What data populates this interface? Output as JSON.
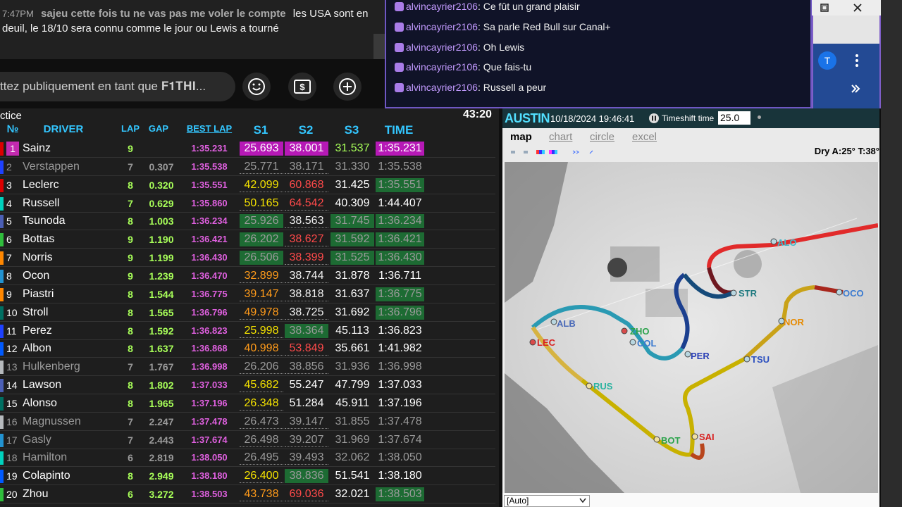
{
  "yt_chat": {
    "time": "7:47PM",
    "author": "sajeu cette fois tu ne vas pas me voler le compte",
    "message": "les USA sont en deuil, le 18/10 sera connu comme le jour ou Lewis a tourné",
    "input_placeholder": "ttez publiquement en tant que 𝐅𝟏𝐓𝐇𝐈...",
    "emoji_icon": "emoji-icon",
    "dollar_icon": "super-chat-icon",
    "add_icon": "add-icon"
  },
  "twitch_chat": {
    "messages": [
      {
        "user": "alvincayrier2106",
        "text": "Ce fût un grand plaisir"
      },
      {
        "user": "alvincayrier2106",
        "text": "Sa parle Red Bull sur Canal+"
      },
      {
        "user": "alvincayrier2106",
        "text": "Oh Lewis"
      },
      {
        "user": "alvincayrier2106",
        "text": "Que fais-tu"
      },
      {
        "user": "alvincayrier2106",
        "text": "Russell a peur"
      }
    ]
  },
  "browser": {
    "avatar_letter": "T"
  },
  "timing": {
    "session": "ctice",
    "clock": "43:20",
    "headers": {
      "no": "№",
      "driver": "DRIVER",
      "lap": "LAP",
      "gap": "GAP",
      "best": "BEST LAP",
      "s1": "S1",
      "s2": "S2",
      "s3": "S3",
      "time": "TIME"
    },
    "rows": [
      {
        "pos": "1",
        "team": "#dc0000",
        "driver": "Sainz",
        "lap": "9",
        "gap": "",
        "best": "1:35.231",
        "s1": "25.693",
        "s2": "38.001",
        "s3": "31.537",
        "time": "1:35.231"
      },
      {
        "pos": "2",
        "team": "#1e41ff",
        "driver": "Verstappen",
        "lap": "7",
        "gap": "0.307",
        "best": "1:35.538",
        "s1": "25.771",
        "s2": "38.171",
        "s3": "31.330",
        "time": "1:35.538"
      },
      {
        "pos": "3",
        "team": "#dc0000",
        "driver": "Leclerc",
        "lap": "8",
        "gap": "0.320",
        "best": "1:35.551",
        "s1": "42.099",
        "s2": "60.868",
        "s3": "31.425",
        "time": "1:35.551"
      },
      {
        "pos": "4",
        "team": "#00d2be",
        "driver": "Russell",
        "lap": "7",
        "gap": "0.629",
        "best": "1:35.860",
        "s1": "50.165",
        "s2": "64.542",
        "s3": "40.309",
        "time": "1:44.407"
      },
      {
        "pos": "5",
        "team": "#4b5fb5",
        "driver": "Tsunoda",
        "lap": "8",
        "gap": "1.003",
        "best": "1:36.234",
        "s1": "25.926",
        "s2": "38.563",
        "s3": "31.745",
        "time": "1:36.234"
      },
      {
        "pos": "6",
        "team": "#2fbd3c",
        "driver": "Bottas",
        "lap": "9",
        "gap": "1.190",
        "best": "1:36.421",
        "s1": "26.202",
        "s2": "38.627",
        "s3": "31.592",
        "time": "1:36.421"
      },
      {
        "pos": "7",
        "team": "#ff8700",
        "driver": "Norris",
        "lap": "9",
        "gap": "1.199",
        "best": "1:36.430",
        "s1": "26.506",
        "s2": "38.399",
        "s3": "31.525",
        "time": "1:36.430"
      },
      {
        "pos": "8",
        "team": "#2293d1",
        "driver": "Ocon",
        "lap": "9",
        "gap": "1.239",
        "best": "1:36.470",
        "s1": "32.899",
        "s2": "38.744",
        "s3": "31.878",
        "time": "1:36.711"
      },
      {
        "pos": "9",
        "team": "#ff8700",
        "driver": "Piastri",
        "lap": "8",
        "gap": "1.544",
        "best": "1:36.775",
        "s1": "39.147",
        "s2": "38.818",
        "s3": "31.637",
        "time": "1:36.775"
      },
      {
        "pos": "10",
        "team": "#006f62",
        "driver": "Stroll",
        "lap": "8",
        "gap": "1.565",
        "best": "1:36.796",
        "s1": "49.978",
        "s2": "38.725",
        "s3": "31.692",
        "time": "1:36.796"
      },
      {
        "pos": "11",
        "team": "#1e41ff",
        "driver": "Perez",
        "lap": "8",
        "gap": "1.592",
        "best": "1:36.823",
        "s1": "25.998",
        "s2": "38.364",
        "s3": "45.113",
        "time": "1:36.823"
      },
      {
        "pos": "12",
        "team": "#005aff",
        "driver": "Albon",
        "lap": "8",
        "gap": "1.637",
        "best": "1:36.868",
        "s1": "40.998",
        "s2": "53.849",
        "s3": "35.661",
        "time": "1:41.982"
      },
      {
        "pos": "13",
        "team": "#b6babd",
        "driver": "Hulkenberg",
        "lap": "7",
        "gap": "1.767",
        "best": "1:36.998",
        "s1": "26.206",
        "s2": "38.856",
        "s3": "31.936",
        "time": "1:36.998"
      },
      {
        "pos": "14",
        "team": "#4b5fb5",
        "driver": "Lawson",
        "lap": "8",
        "gap": "1.802",
        "best": "1:37.033",
        "s1": "45.682",
        "s2": "55.247",
        "s3": "47.799",
        "time": "1:37.033"
      },
      {
        "pos": "15",
        "team": "#006f62",
        "driver": "Alonso",
        "lap": "8",
        "gap": "1.965",
        "best": "1:37.196",
        "s1": "26.348",
        "s2": "51.284",
        "s3": "45.911",
        "time": "1:37.196"
      },
      {
        "pos": "16",
        "team": "#b6babd",
        "driver": "Magnussen",
        "lap": "7",
        "gap": "2.247",
        "best": "1:37.478",
        "s1": "26.473",
        "s2": "39.147",
        "s3": "31.855",
        "time": "1:37.478"
      },
      {
        "pos": "17",
        "team": "#2293d1",
        "driver": "Gasly",
        "lap": "7",
        "gap": "2.443",
        "best": "1:37.674",
        "s1": "26.498",
        "s2": "39.207",
        "s3": "31.969",
        "time": "1:37.674"
      },
      {
        "pos": "18",
        "team": "#00d2be",
        "driver": "Hamilton",
        "lap": "6",
        "gap": "2.819",
        "best": "1:38.050",
        "s1": "26.495",
        "s2": "39.493",
        "s3": "32.062",
        "time": "1:38.050"
      },
      {
        "pos": "19",
        "team": "#005aff",
        "driver": "Colapinto",
        "lap": "8",
        "gap": "2.949",
        "best": "1:38.180",
        "s1": "26.400",
        "s2": "38.836",
        "s3": "51.541",
        "time": "1:38.180"
      },
      {
        "pos": "20",
        "team": "#2fbd3c",
        "driver": "Zhou",
        "lap": "6",
        "gap": "3.272",
        "best": "1:38.503",
        "s1": "43.738",
        "s2": "69.036",
        "s3": "32.021",
        "time": "1:38.503"
      }
    ]
  },
  "map": {
    "title": "AUSTIN",
    "datetime": "10/18/2024 19:46:41",
    "timeshift_label": "Timeshift time",
    "timeshift_value": "25.0",
    "tabs": [
      "map",
      "chart",
      "circle",
      "excel"
    ],
    "weather": "Dry A:25° T:38°",
    "dropdown": "[Auto]",
    "cars": [
      "ALO",
      "STR",
      "TSU",
      "NOR",
      "PER",
      "COL",
      "ZHO",
      "ALB",
      "LEC",
      "RUS",
      "BOT",
      "SAI",
      "OCO"
    ]
  }
}
